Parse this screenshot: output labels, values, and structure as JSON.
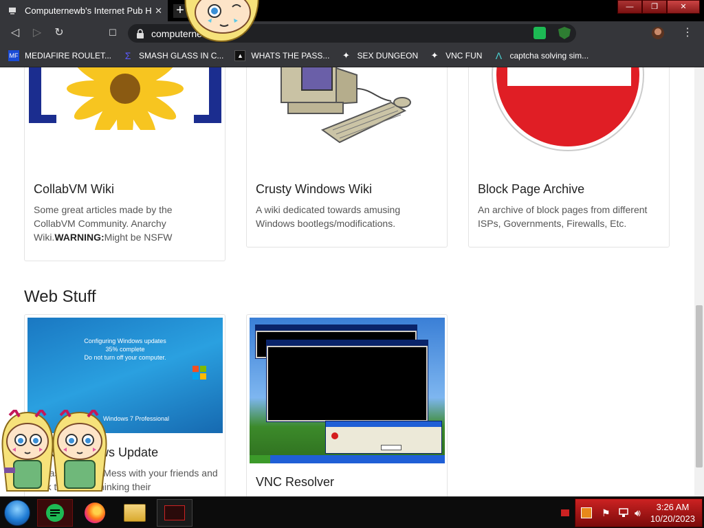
{
  "tab": {
    "title": "Computernewb's Internet Pub Hub",
    "close": "✕",
    "new_tab": "+"
  },
  "window_buttons": {
    "minimize": "—",
    "maximize": "❐",
    "close": "✕"
  },
  "toolbar": {
    "back": "◁",
    "forward": "▷",
    "reload": "↻",
    "bookmark": "☐",
    "url": "computernewb",
    "menu": "⋮"
  },
  "bookmarks": [
    {
      "label": "MEDIAFIRE ROULET...",
      "icon": "MF"
    },
    {
      "label": "SMASH GLASS IN C...",
      "icon": "Σ"
    },
    {
      "label": "WHATS THE PASS...",
      "icon": "▲"
    },
    {
      "label": "SEX DUNGEON",
      "icon": "✦"
    },
    {
      "label": "VNC FUN",
      "icon": "✦"
    },
    {
      "label": "captcha solving sim...",
      "icon": "Λ"
    }
  ],
  "cards": {
    "collabvm": {
      "title": "CollabVM Wiki",
      "desc_prefix": "Some great articles made by the CollabVM Community. Anarchy Wiki.",
      "desc_bold": "WARNING:",
      "desc_suffix": "Might be NSFW"
    },
    "crusty": {
      "title": "Crusty Windows Wiki",
      "desc": "A wiki dedicated towards amusing Windows bootlegs/modifications."
    },
    "blockpage": {
      "title": "Block Page Archive",
      "desc": "An archive of block pages from different ISPs, Governments, Firewalls, Etc."
    },
    "fakeupdate": {
      "title": "Fake Windows Update",
      "desc": "A classic prank. Mess with your friends and trick them into thinking their",
      "screen_line1": "Configuring Windows updates",
      "screen_line2": "35% complete",
      "screen_line3": "Do not turn off your computer.",
      "screen_brand": "Windows 7 Professional"
    },
    "vnc": {
      "title": "VNC Resolver"
    }
  },
  "section": {
    "web_stuff": "Web Stuff"
  },
  "clock": {
    "time": "3:26 AM",
    "date": "10/20/2023"
  },
  "colors": {
    "page_bg": "#ffffff",
    "tab_bg": "#35363a",
    "tray_red": "#b31a1a"
  }
}
